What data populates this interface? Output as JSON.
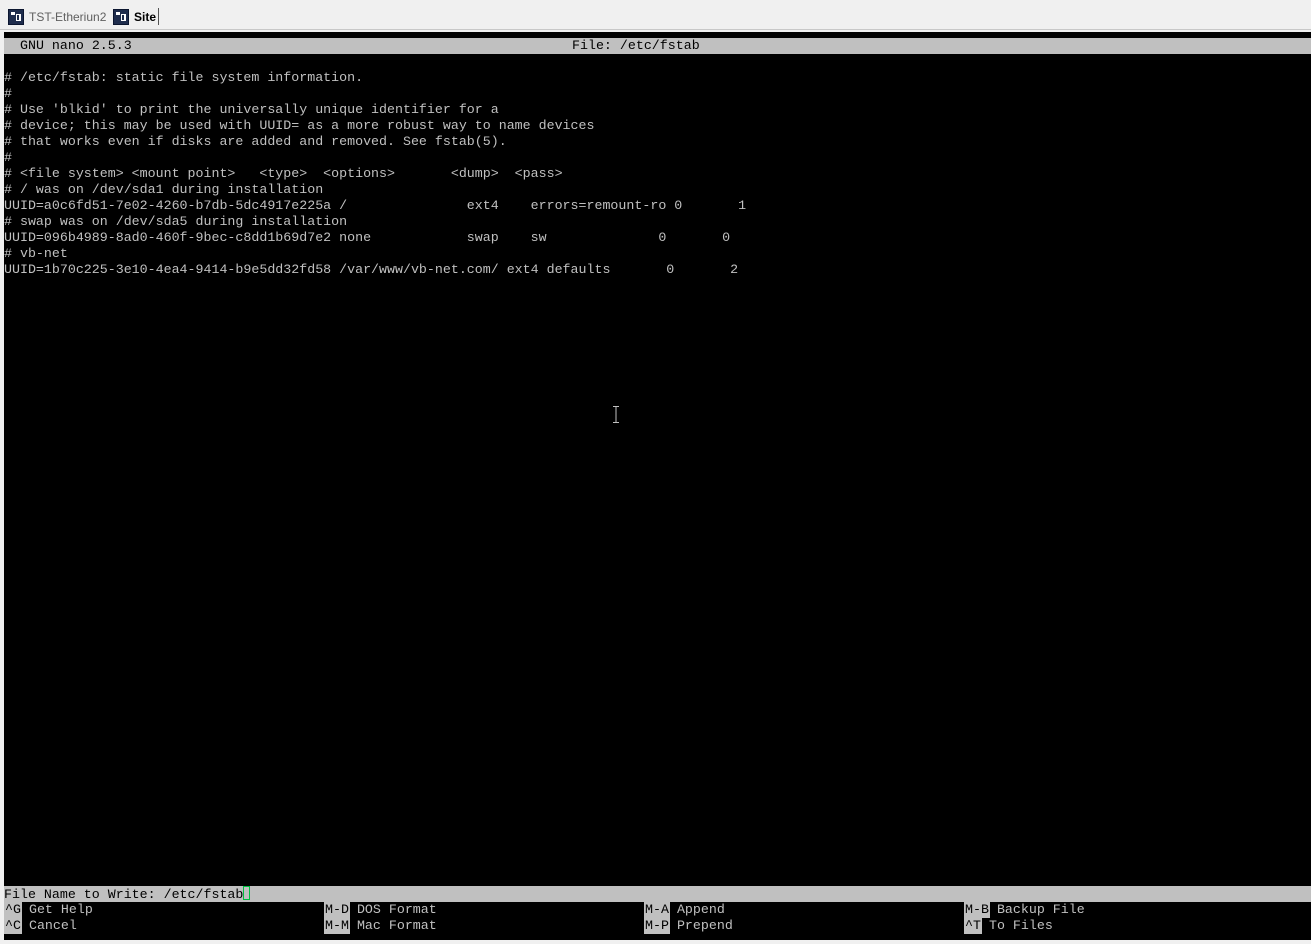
{
  "tabs": [
    {
      "label": "TST-Etheriun2",
      "active": false
    },
    {
      "label": "Site",
      "active": true
    }
  ],
  "nano": {
    "version": "GNU nano 2.5.3",
    "file_title": "File: /etc/fstab"
  },
  "content": [
    "# /etc/fstab: static file system information.",
    "#",
    "# Use 'blkid' to print the universally unique identifier for a",
    "# device; this may be used with UUID= as a more robust way to name devices",
    "# that works even if disks are added and removed. See fstab(5).",
    "#",
    "# <file system> <mount point>   <type>  <options>       <dump>  <pass>",
    "# / was on /dev/sda1 during installation",
    "UUID=a0c6fd51-7e02-4260-b7db-5dc4917e225a /               ext4    errors=remount-ro 0       1",
    "# swap was on /dev/sda5 during installation",
    "UUID=096b4989-8ad0-460f-9bec-c8dd1b69d7e2 none            swap    sw              0       0",
    "# vb-net",
    "UUID=1b70c225-3e10-4ea4-9414-b9e5dd32fd58 /var/www/vb-net.com/ ext4 defaults       0       2"
  ],
  "prompt": {
    "label": "File Name to Write: /etc/fstab"
  },
  "shortcuts": [
    {
      "key": "^G",
      "label": "Get Help"
    },
    {
      "key": "^C",
      "label": "Cancel"
    },
    {
      "key": "M-D",
      "label": "DOS Format"
    },
    {
      "key": "M-M",
      "label": "Mac Format"
    },
    {
      "key": "M-A",
      "label": "Append"
    },
    {
      "key": "M-P",
      "label": "Prepend"
    },
    {
      "key": "M-B",
      "label": "Backup File"
    },
    {
      "key": "^T",
      "label": "To Files"
    }
  ],
  "colors": {
    "terminal_bg": "#000000",
    "terminal_fg": "#c0c0c0",
    "status_bar_bg": "#c0c0c0",
    "cursor": "#00c040"
  }
}
